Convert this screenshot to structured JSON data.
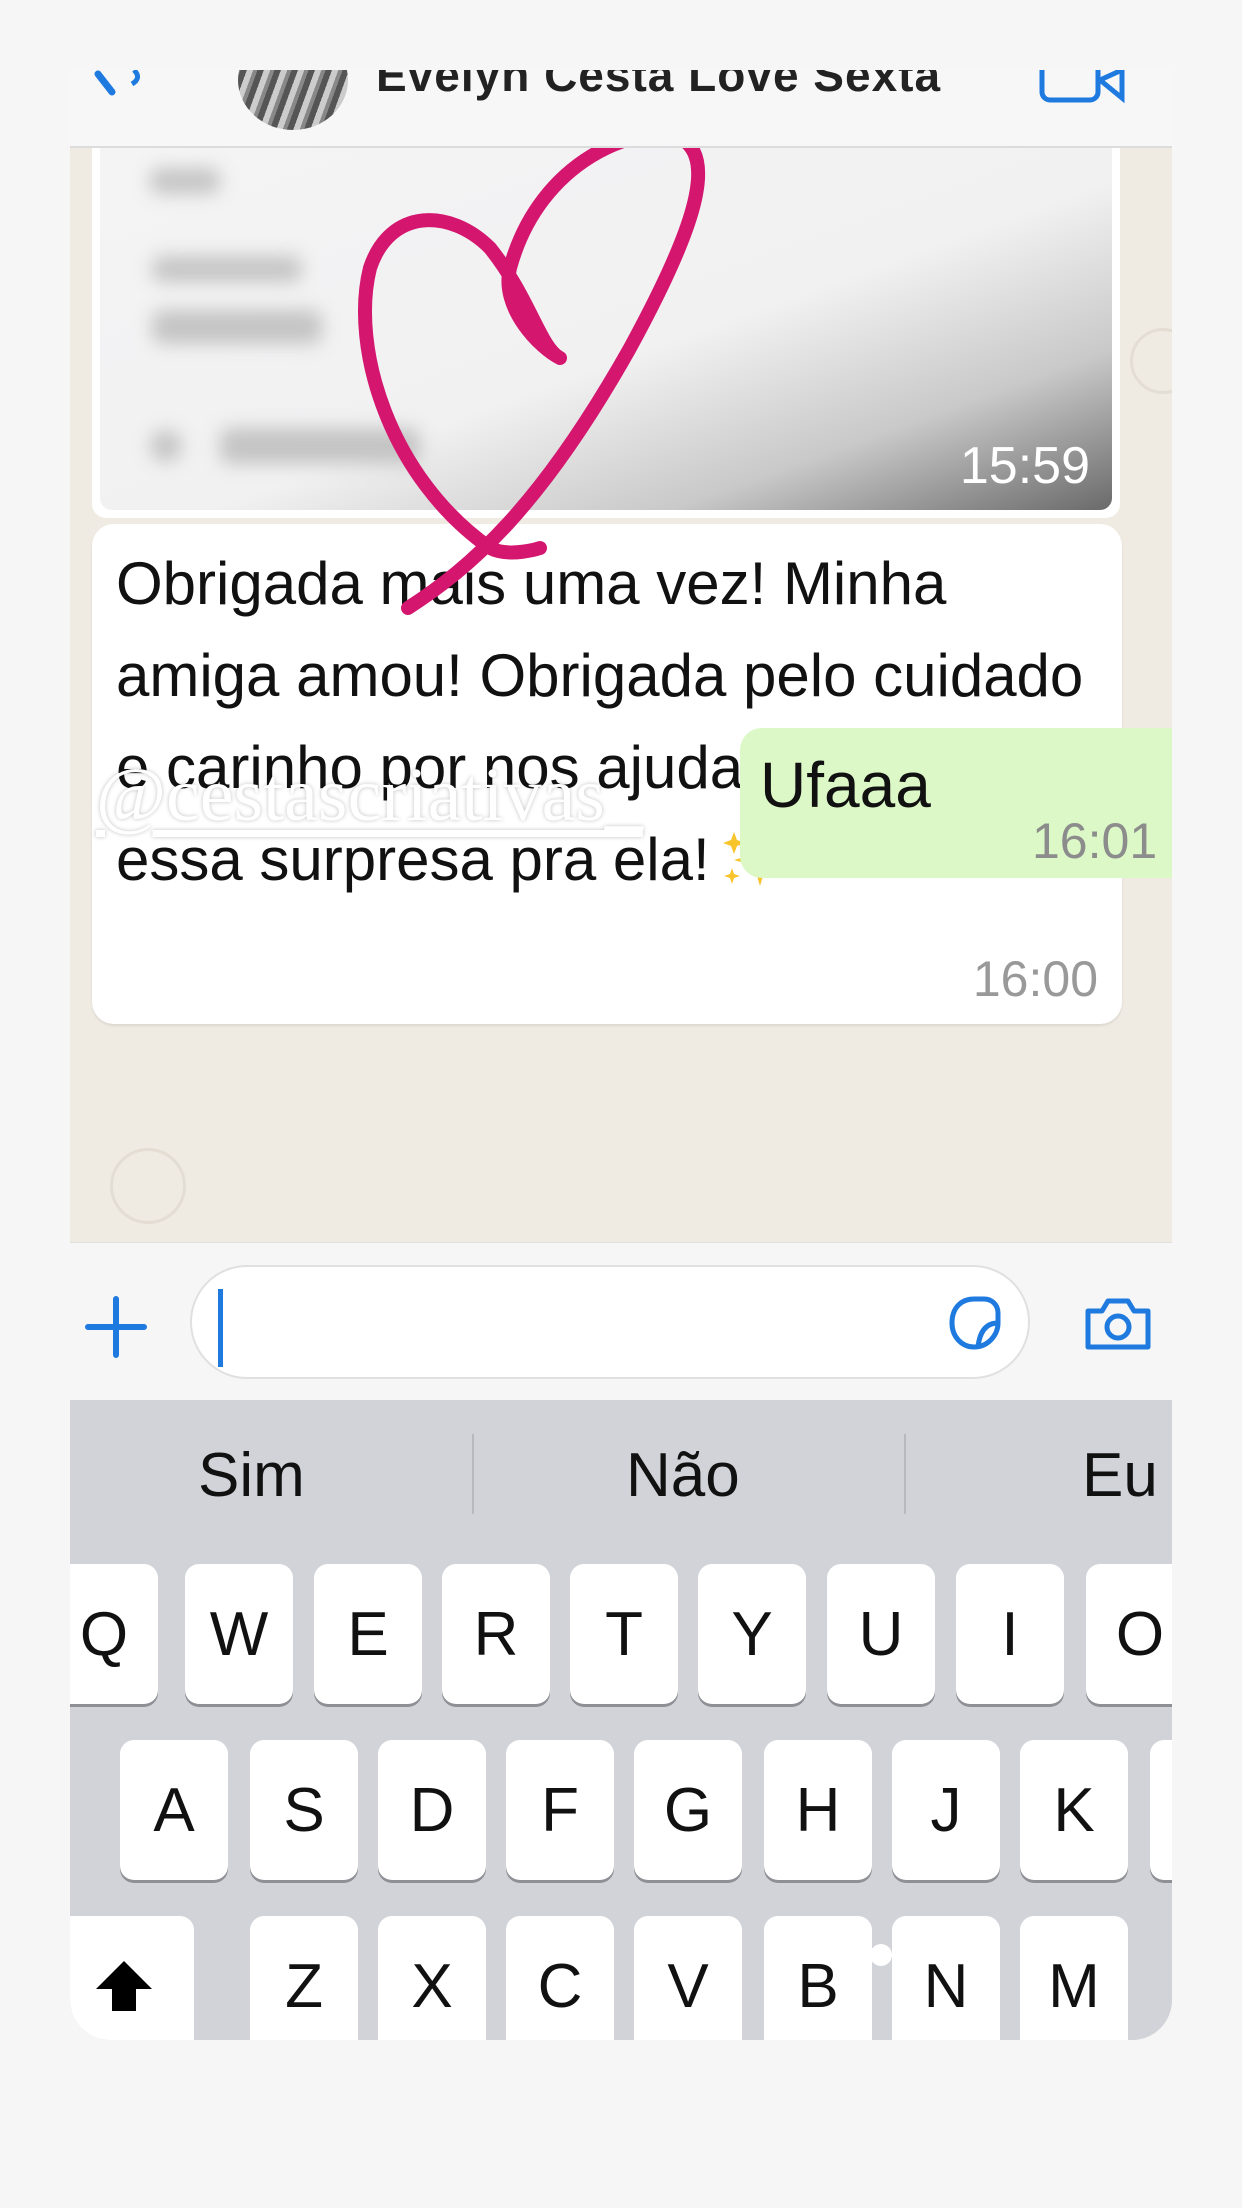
{
  "header": {
    "contact_name": "Evelyn Cesta Love Sexta",
    "back_icon": "chevron-left-icon",
    "video_icon": "video-camera-icon"
  },
  "messages": {
    "image_message": {
      "time": "15:59"
    },
    "received_message": {
      "text": "Obrigada mais uma vez! Minha amiga amou! Obrigada pelo cuidado e carinho por nos ajudar a preparar essa surpresa pra ela!",
      "emoji": "sparkles-emoji",
      "time": "16:00"
    },
    "sent_message": {
      "text": "Ufaaa",
      "time": "16:01"
    }
  },
  "overlay": {
    "watermark": "@cestascriativas_",
    "heart_color": "#d4166f"
  },
  "input_bar": {
    "plus_icon": "plus-icon",
    "sticker_icon": "sticker-icon",
    "camera_icon": "camera-icon",
    "accent_color": "#1f7ae0"
  },
  "keyboard": {
    "suggestions": [
      "Sim",
      "Não",
      "Eu"
    ],
    "row1": [
      "Q",
      "W",
      "E",
      "R",
      "T",
      "Y",
      "U",
      "I",
      "O"
    ],
    "row2": [
      "A",
      "S",
      "D",
      "F",
      "G",
      "H",
      "J",
      "K"
    ],
    "row3": [
      "Z",
      "X",
      "C",
      "V",
      "B",
      "N",
      "M"
    ],
    "shift_icon": "shift-arrow-icon"
  },
  "colors": {
    "chat_background": "#efeae2",
    "sent_bubble": "#dcf8c6",
    "received_bubble": "#ffffff",
    "keyboard_background": "#d1d3d9"
  }
}
